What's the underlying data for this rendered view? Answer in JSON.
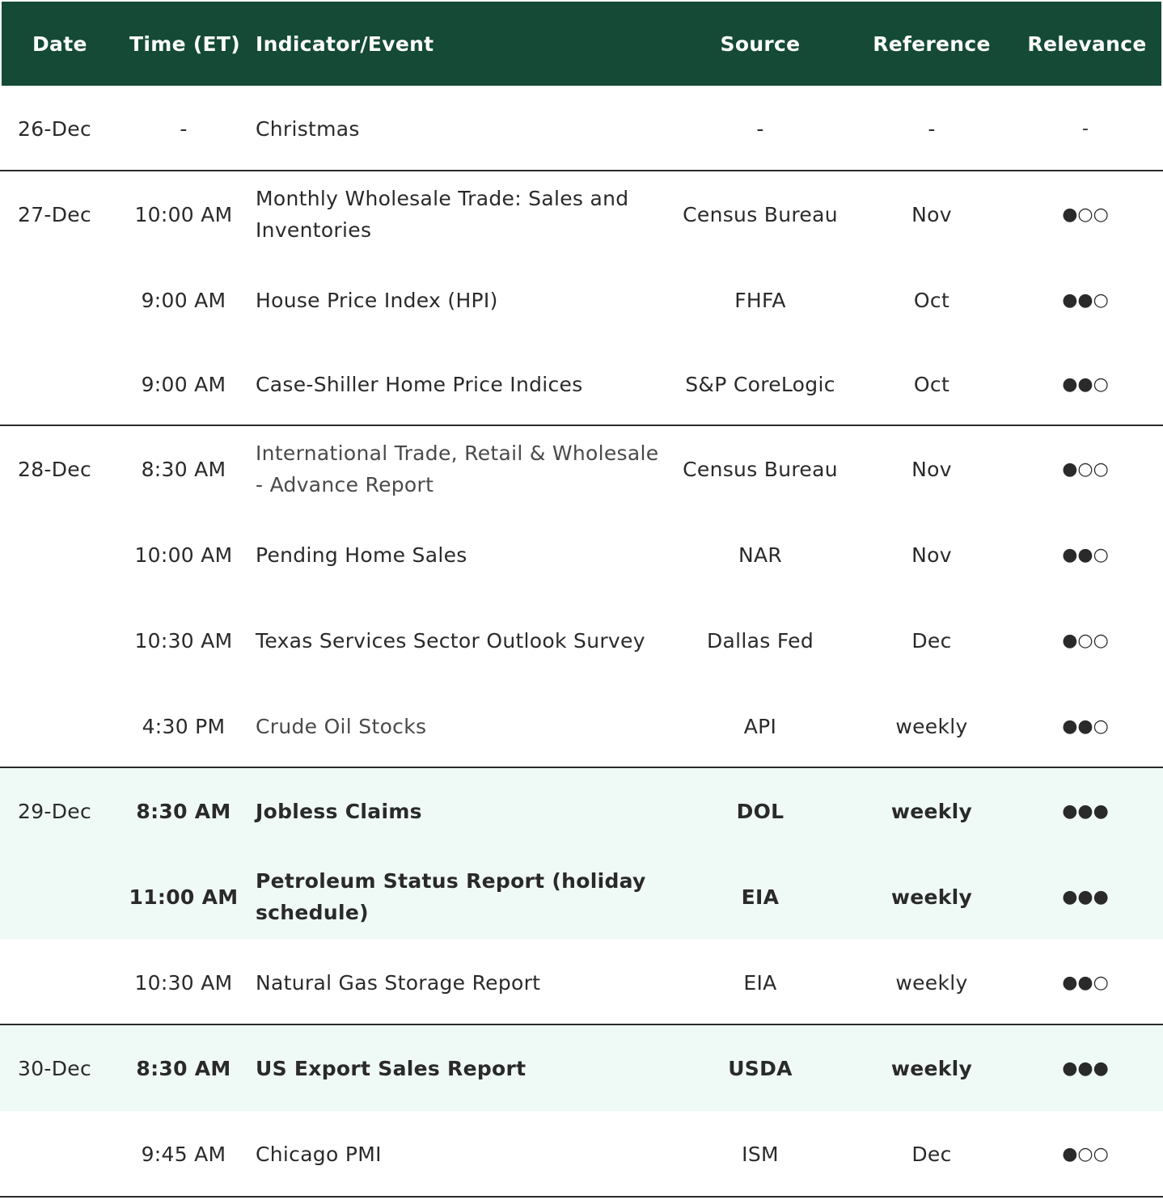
{
  "header": {
    "date": "Date",
    "time": "Time (ET)",
    "event": "Indicator/Event",
    "source": "Source",
    "reference": "Reference",
    "relevance": "Relevance"
  },
  "rows": [
    {
      "date": "26-Dec",
      "time": "-",
      "event": "Christmas",
      "source": "-",
      "reference": "-",
      "relevance": "-"
    },
    {
      "date": "27-Dec",
      "time": "10:00 AM",
      "event": "Monthly Wholesale Trade: Sales and Inventories",
      "source": "Census Bureau",
      "reference": "Nov",
      "relevance": "●○○"
    },
    {
      "date": "",
      "time": "9:00 AM",
      "event": "House Price Index (HPI)",
      "source": "FHFA",
      "reference": "Oct",
      "relevance": "●●○"
    },
    {
      "date": "",
      "time": "9:00 AM",
      "event": "Case-Shiller Home Price Indices",
      "source": "S&P CoreLogic",
      "reference": "Oct",
      "relevance": "●●○"
    },
    {
      "date": "28-Dec",
      "time": "8:30 AM",
      "event": "International Trade, Retail & Wholesale - Advance Report",
      "source": "Census Bureau",
      "reference": "Nov",
      "relevance": "●○○"
    },
    {
      "date": "",
      "time": "10:00 AM",
      "event": "Pending Home Sales",
      "source": "NAR",
      "reference": "Nov",
      "relevance": "●●○"
    },
    {
      "date": "",
      "time": "10:30 AM",
      "event": "Texas Services Sector Outlook Survey",
      "source": "Dallas Fed",
      "reference": "Dec",
      "relevance": "●○○"
    },
    {
      "date": "",
      "time": "4:30 PM",
      "event": "Crude Oil Stocks",
      "source": "API",
      "reference": "weekly",
      "relevance": "●●○"
    },
    {
      "date": "29-Dec",
      "time": "8:30 AM",
      "event": "Jobless Claims",
      "source": "DOL",
      "reference": "weekly",
      "relevance": "●●●"
    },
    {
      "date": "",
      "time": "11:00 AM",
      "event": "Petroleum Status Report (holiday schedule)",
      "source": "EIA",
      "reference": "weekly",
      "relevance": "●●●"
    },
    {
      "date": "",
      "time": "10:30 AM",
      "event": "Natural Gas Storage Report",
      "source": "EIA",
      "reference": "weekly",
      "relevance": "●●○"
    },
    {
      "date": "30-Dec",
      "time": "8:30 AM",
      "event": "US Export Sales Report",
      "source": "USDA",
      "reference": "weekly",
      "relevance": "●●●"
    },
    {
      "date": "",
      "time": "9:45 AM",
      "event": "Chicago PMI",
      "source": "ISM",
      "reference": "Dec",
      "relevance": "●○○"
    }
  ]
}
